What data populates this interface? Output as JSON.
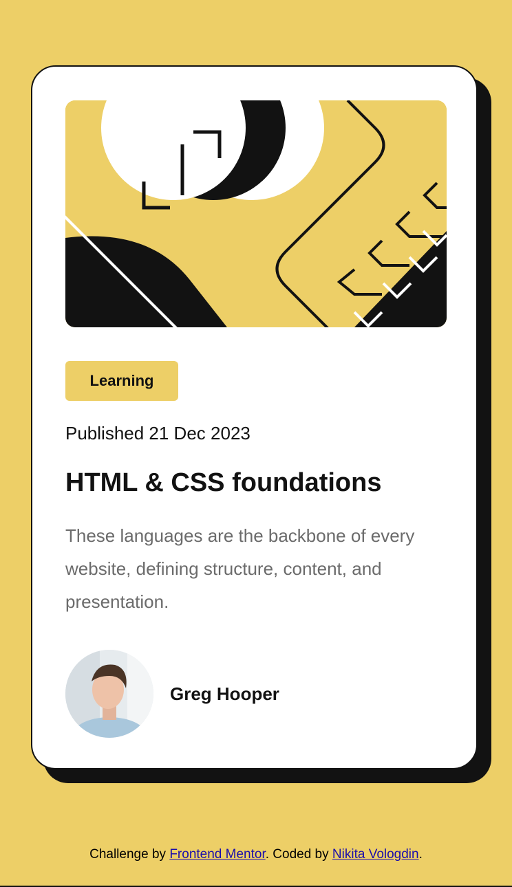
{
  "card": {
    "tag": "Learning",
    "published": "Published 21 Dec 2023",
    "title": "HTML & CSS foundations",
    "description": "These languages are the backbone of every website, defining structure, content, and presentation.",
    "author": "Greg Hooper"
  },
  "footer": {
    "prefix": "Challenge by ",
    "link1": "Frontend Mentor",
    "middle": ". Coded by ",
    "link2": "Nikita Vologdin",
    "suffix": "."
  },
  "colors": {
    "background": "#EDCF67",
    "dark": "#121212",
    "card": "#FFFFFF",
    "muted_text": "#6B6B6B"
  },
  "icons": {
    "hero": "abstract-illustration",
    "avatar": "author-photo"
  }
}
